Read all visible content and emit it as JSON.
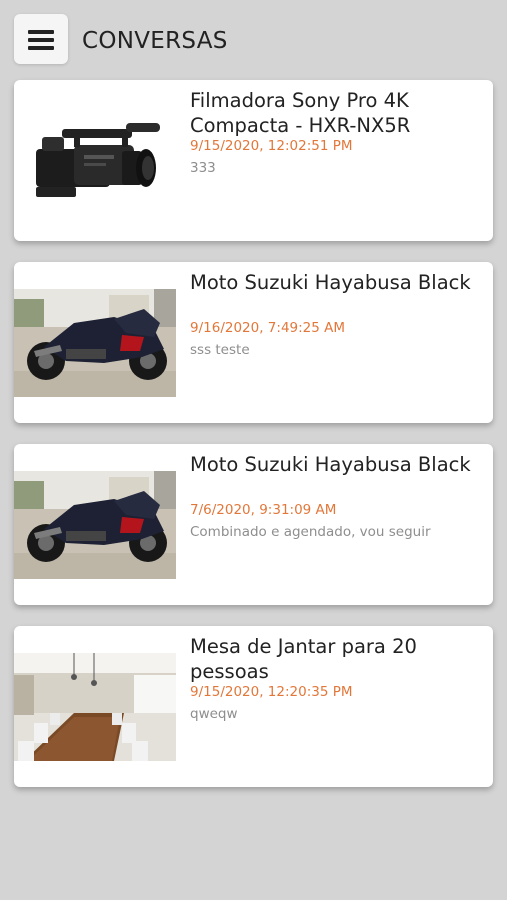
{
  "header": {
    "title": "CONVERSAS",
    "menu_icon": "hamburger-menu-icon"
  },
  "conversations": [
    {
      "title": "Filmadora Sony Pro 4K Compacta - HXR-NX5R",
      "date": "9/15/2020, 12:02:51 PM",
      "message": "333",
      "image": "camcorder-image"
    },
    {
      "title": "Moto Suzuki Hayabusa Black",
      "date": "9/16/2020, 7:49:25 AM",
      "message": "sss teste",
      "image": "motorcycle-image"
    },
    {
      "title": "Moto Suzuki Hayabusa Black",
      "date": "7/6/2020, 9:31:09 AM",
      "message": "Combinado e agendado, vou seguir",
      "image": "motorcycle-image"
    },
    {
      "title": "Mesa de Jantar para 20 pessoas",
      "date": "9/15/2020, 12:20:35 PM",
      "message": "qweqw",
      "image": "dining-table-image"
    }
  ],
  "colors": {
    "background": "#d4d4d4",
    "date_accent": "#e2773a",
    "message_text": "#8e8e8e"
  }
}
